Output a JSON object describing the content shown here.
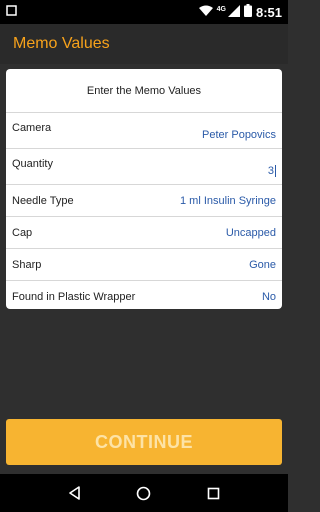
{
  "status_bar": {
    "network_label": "4G",
    "time": "8:51"
  },
  "app_bar": {
    "title": "Memo Values"
  },
  "form": {
    "header": "Enter the Memo Values",
    "rows": [
      {
        "label": "Camera",
        "value": "Peter Popovics"
      },
      {
        "label": "Quantity",
        "value": "3"
      },
      {
        "label": "Needle Type",
        "value": "1 ml Insulin Syringe"
      },
      {
        "label": "Cap",
        "value": "Uncapped"
      },
      {
        "label": "Sharp",
        "value": "Gone"
      },
      {
        "label": "Found in Plastic Wrapper",
        "value": "No"
      }
    ]
  },
  "continue_button": {
    "label": "CONTINUE"
  },
  "colors": {
    "accent": "#f7a21b",
    "button": "#f7b431",
    "value_text": "#2a5aa8"
  },
  "icons": {
    "status_left": "notification-square-icon",
    "status_right": [
      "wifi-icon",
      "cellular-signal-icon",
      "battery-icon"
    ],
    "nav": [
      "back-icon",
      "home-icon",
      "recents-icon"
    ]
  }
}
